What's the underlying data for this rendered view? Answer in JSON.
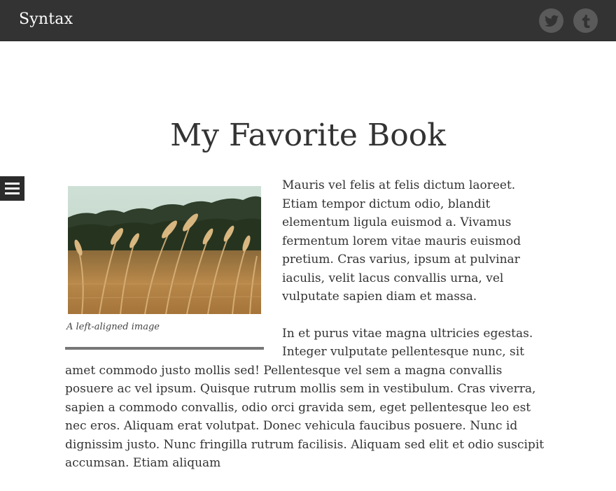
{
  "header": {
    "site_title": "Syntax",
    "social": [
      {
        "icon": "twitter-icon"
      },
      {
        "icon": "tumblr-icon"
      }
    ]
  },
  "post": {
    "title": "My Favorite Book",
    "figure": {
      "caption": "A left-aligned image"
    },
    "paragraphs": [
      "Mauris vel felis at felis dictum laoreet. Etiam tempor dictum odio, blandit elementum ligula euismod a. Vivamus fermentum lorem vitae mauris euismod pretium. Cras varius, ipsum at pulvinar iaculis, velit lacus convallis urna, vel vulputate sapien diam et massa.",
      "In et purus vitae magna ultricies egestas. Integer vulputate pellentesque nunc, sit amet commodo justo mollis sed! Pellentesque vel sem a magna convallis posuere ac vel ipsum. Quisque rutrum mollis sem in vestibulum. Cras viverra, sapien a commodo convallis, odio orci gravida sem, eget pellentesque leo est nec eros. Aliquam erat volutpat. Donec vehicula faucibus posuere. Nunc id dignissim justo. Nunc fringilla rutrum facilisis. Aliquam sed elit et odio suscipit accumsan. Etiam aliquam"
    ]
  },
  "colors": {
    "header_bg": "#333333",
    "text": "#333333",
    "social_bg": "#5a5a5a"
  }
}
